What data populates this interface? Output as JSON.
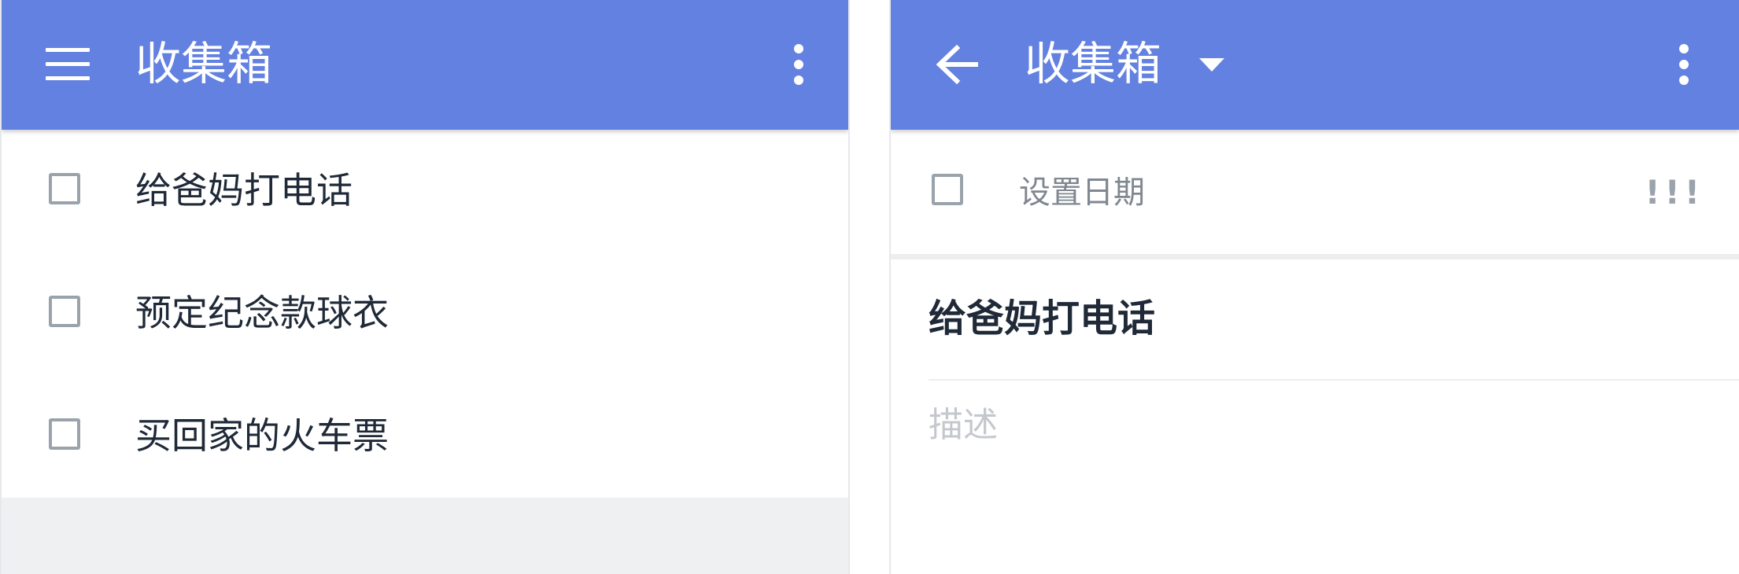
{
  "left_screen": {
    "appbar": {
      "title": "收集箱"
    },
    "tasks": [
      {
        "label": "给爸妈打电话"
      },
      {
        "label": "预定纪念款球衣"
      },
      {
        "label": "买回家的火车票"
      }
    ]
  },
  "right_screen": {
    "appbar": {
      "title": "收集箱"
    },
    "date_row": {
      "label": "设置日期",
      "priority": "!!!"
    },
    "task_title": "给爸妈打电话",
    "description_placeholder": "描述"
  },
  "colors": {
    "appbar": "#6381e0",
    "text_primary": "#1f2937",
    "text_muted": "#7f8790",
    "placeholder": "#c4c8cd",
    "checkbox_border": "#9aa2ab",
    "page_background": "#eff0f2"
  },
  "icons": {
    "menu": "hamburger-icon",
    "overflow": "more-vert-icon",
    "back": "arrow-left-icon",
    "dropdown": "caret-down-icon"
  }
}
